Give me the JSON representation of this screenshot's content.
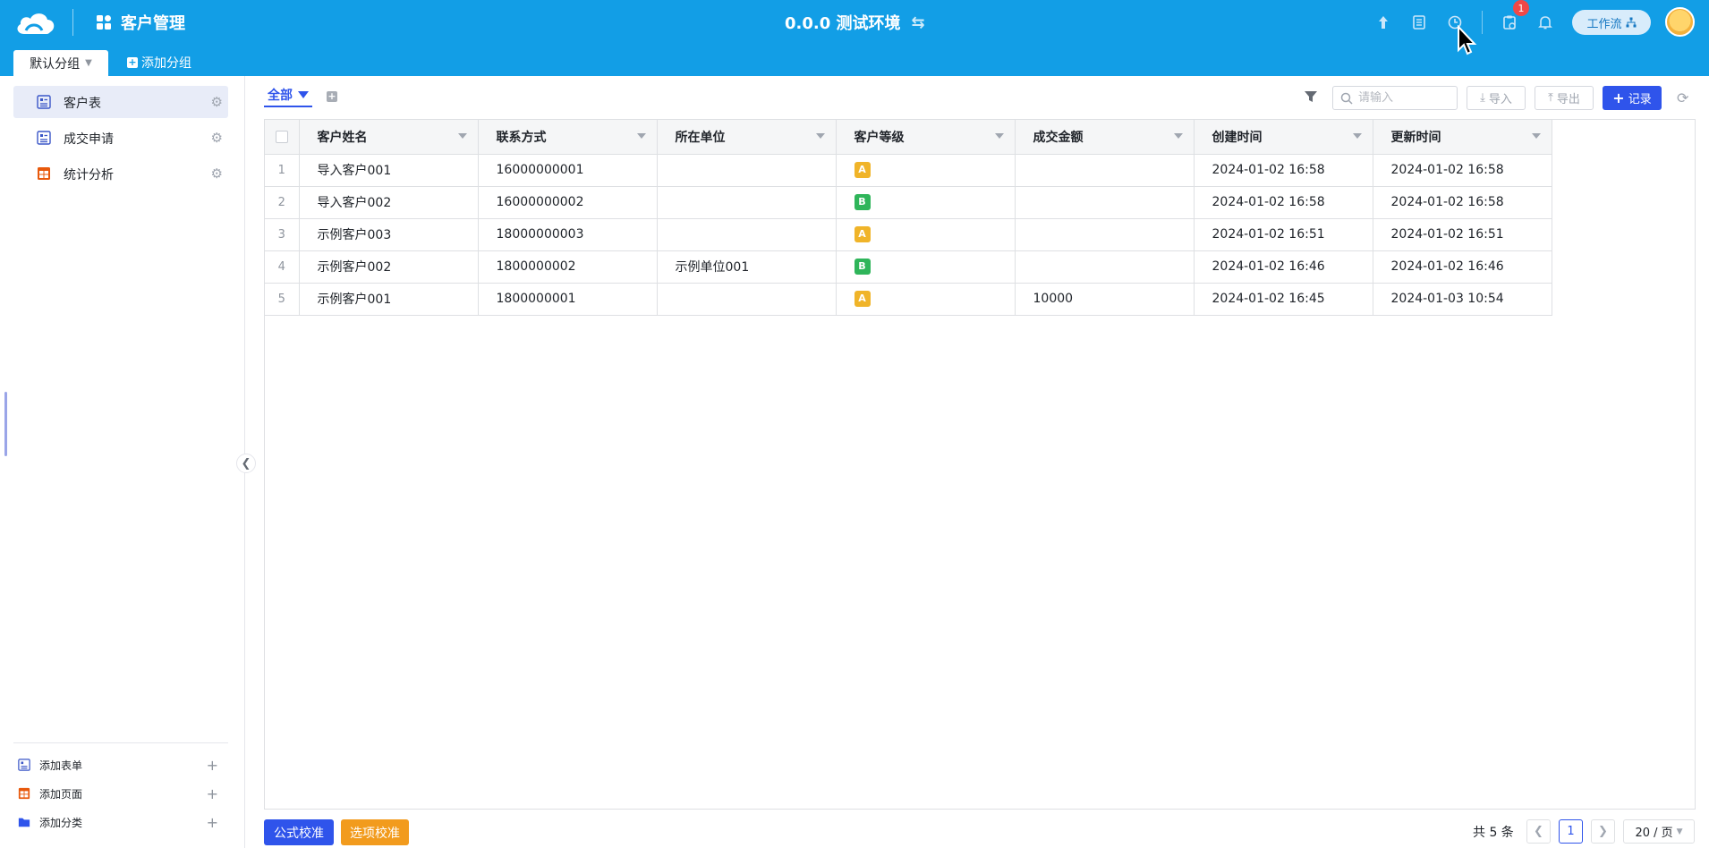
{
  "header": {
    "app_title": "客户管理",
    "env_label": "0.0.0 测试环境",
    "notification_count": "1",
    "workflow_label": "工作流",
    "colors": {
      "topbar": "#129ee6",
      "primary": "#2f54eb"
    },
    "icons": [
      "cloud-logo-icon",
      "apps-icon",
      "swap-icon",
      "upload-icon",
      "document-icon",
      "history-clock-icon",
      "clipboard-icon",
      "bell-icon",
      "org-chart-icon"
    ]
  },
  "groups": {
    "active_tab": "默认分组",
    "add_label": "添加分组"
  },
  "sidebar": {
    "items": [
      {
        "label": "客户表",
        "icon": "form-icon",
        "active": true
      },
      {
        "label": "成交申请",
        "icon": "form-icon",
        "active": false
      },
      {
        "label": "统计分析",
        "icon": "table-grid-icon",
        "active": false
      }
    ],
    "bottom": [
      {
        "label": "添加表单",
        "icon": "form-icon"
      },
      {
        "label": "添加页面",
        "icon": "table-grid-icon"
      },
      {
        "label": "添加分类",
        "icon": "folder-icon"
      }
    ]
  },
  "toolbar": {
    "view_tab": "全部",
    "search_placeholder": "请输入",
    "import_label": "导入",
    "export_label": "导出",
    "record_label": "记录"
  },
  "table": {
    "columns": [
      "客户姓名",
      "联系方式",
      "所在单位",
      "客户等级",
      "成交金额",
      "创建时间",
      "更新时间"
    ],
    "rows": [
      {
        "index": "1",
        "name": "导入客户001",
        "contact": "16000000001",
        "company": "",
        "level": "A",
        "amount": "",
        "created": "2024-01-02 16:58",
        "updated": "2024-01-02 16:58"
      },
      {
        "index": "2",
        "name": "导入客户002",
        "contact": "16000000002",
        "company": "",
        "level": "B",
        "amount": "",
        "created": "2024-01-02 16:58",
        "updated": "2024-01-02 16:58"
      },
      {
        "index": "3",
        "name": "示例客户003",
        "contact": "18000000003",
        "company": "",
        "level": "A",
        "amount": "",
        "created": "2024-01-02 16:51",
        "updated": "2024-01-02 16:51"
      },
      {
        "index": "4",
        "name": "示例客户002",
        "contact": "1800000002",
        "company": "示例单位001",
        "level": "B",
        "amount": "",
        "created": "2024-01-02 16:46",
        "updated": "2024-01-02 16:46"
      },
      {
        "index": "5",
        "name": "示例客户001",
        "contact": "1800000001",
        "company": "",
        "level": "A",
        "amount": "10000",
        "created": "2024-01-02 16:45",
        "updated": "2024-01-03 10:54"
      }
    ],
    "level_colors": {
      "A": "#f0b429",
      "B": "#2fb55a"
    }
  },
  "footer": {
    "formula_check": "公式校准",
    "option_check": "选项校准",
    "formula_color": "#2f54eb",
    "option_color": "#f29b1d",
    "total": "共 5 条",
    "current_page": "1",
    "page_size": "20 / 页"
  }
}
